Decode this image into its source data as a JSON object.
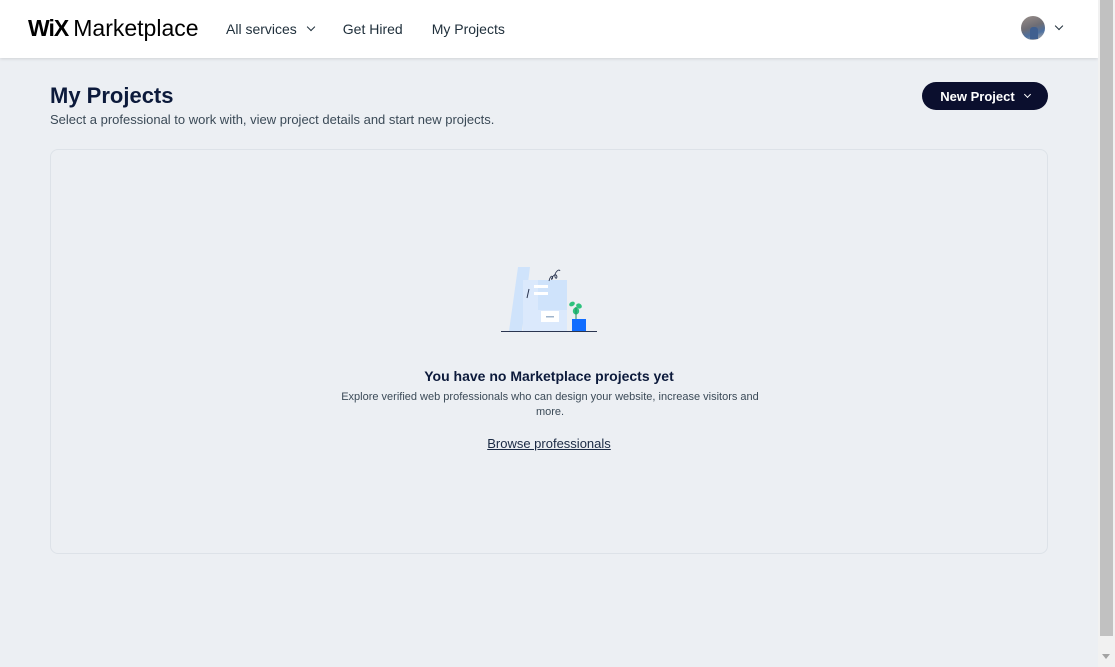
{
  "header": {
    "logo_wix": "WiX",
    "logo_marketplace": "Marketplace",
    "nav": [
      {
        "label": "All services",
        "has_dropdown": true
      },
      {
        "label": "Get Hired",
        "has_dropdown": false
      },
      {
        "label": "My Projects",
        "has_dropdown": false
      }
    ],
    "avatar_icon": "user-avatar"
  },
  "main": {
    "title": "My Projects",
    "subtitle": "Select a professional to work with, view project details and start new projects.",
    "new_project_label": "New Project"
  },
  "empty_state": {
    "illustration": "desk-with-plant-illustration",
    "title": "You have no Marketplace projects yet",
    "description": "Explore verified web professionals who can design your website, increase visitors and more.",
    "link_label": "Browse professionals"
  },
  "colors": {
    "page_bg": "#eceff3",
    "header_bg": "#ffffff",
    "primary_button": "#0b0f2e",
    "illustration_blue": "#cfe3fb",
    "illustration_accent": "#116dff"
  }
}
